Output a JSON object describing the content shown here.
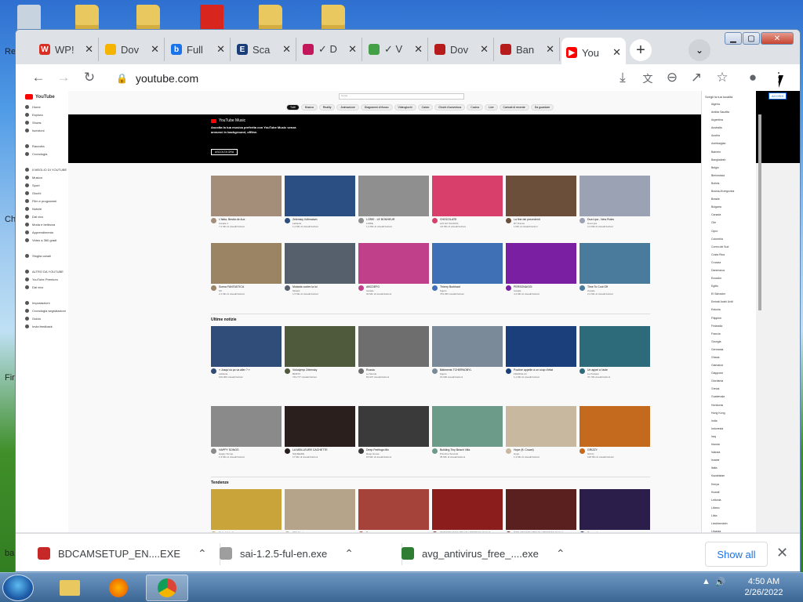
{
  "browser": {
    "tabs": [
      {
        "title": "WP!",
        "fav_color": "#d93025",
        "fav_letter": "W"
      },
      {
        "title": "Dov",
        "fav_color": "#f4b400",
        "fav_letter": ""
      },
      {
        "title": "Full",
        "fav_color": "#1a73e8",
        "fav_letter": "b"
      },
      {
        "title": "Sca",
        "fav_color": "#1a3e7a",
        "fav_letter": "E"
      },
      {
        "title": "✓ D",
        "fav_color": "#c2185b",
        "fav_letter": ""
      },
      {
        "title": "✓ V",
        "fav_color": "#43a047",
        "fav_letter": ""
      },
      {
        "title": "Dov",
        "fav_color": "#b71c1c",
        "fav_letter": ""
      },
      {
        "title": "Ban",
        "fav_color": "#b71c1c",
        "fav_letter": ""
      },
      {
        "title": "You",
        "fav_color": "#ff0000",
        "fav_letter": "▶"
      }
    ],
    "close_glyph": "✕",
    "new_tab_glyph": "+",
    "url": "youtube.com"
  },
  "youtube": {
    "logo": "YouTube",
    "search_placeholder": "Cerca",
    "sidebar": [
      "Home",
      "Esplora",
      "Shorts",
      "Iscrizioni",
      "",
      "Raccolta",
      "Cronologia",
      "",
      "Il MEGLIO DI YOUTUBE",
      "Musica",
      "Sport",
      "Giochi",
      "Film e programmi",
      "Notizie",
      "Dal vivo",
      "Moda e bellezza",
      "Apprendimento",
      "Video a 360 gradi",
      "",
      "Sfoglia canali",
      "",
      "ALTRO DA YOUTUBE",
      "YouTube Premium",
      "Dal vivo",
      "",
      "Impostazioni",
      "Cronologia segnalazioni",
      "Guida",
      "Invia feedback"
    ],
    "chips": [
      "Tutti",
      "Musica",
      "Reality",
      "Animazione",
      "Diagrammi di flusso",
      "Videogiochi",
      "Calcio",
      "Giochi d'avventura",
      "Cucina",
      "Live",
      "Caricati di recente",
      "Da guardare"
    ],
    "banner": {
      "label": "YouTube Music",
      "text": "Ascolta la tua musica preferita con YouTube Music senza annunci in background, offline.",
      "button": "ASCOLTA ORA"
    },
    "login": "ACCEDI",
    "rows": [
      {
        "videos": [
          {
            "title": "L'Italia, Bestia de Aux",
            "channel": "Canale 1",
            "views": "7,2 Mln di visualizzazioni",
            "thumb": "#a48e7a"
          },
          {
            "title": "Zelensky l'ultimatum",
            "channel": "LaDante",
            "views": "1,2 Mln di visualizzazioni",
            "thumb": "#2b4f82"
          },
          {
            "title": "LORIE - LE BONHEUR",
            "channel": "LORIE",
            "views": "1,4 Mln di visualizzazioni",
            "thumb": "#8f8f8f"
          },
          {
            "title": "CHOCOLATE",
            "channel": "123 GO SCHOOL",
            "views": "4,6 Mln di visualizzazioni",
            "thumb": "#d83f6b"
          },
          {
            "title": "La fine dei precedenti",
            "channel": "RT France",
            "views": "1 Mln di visualizzazioni",
            "thumb": "#6b4f3a"
          },
          {
            "title": "Dua Lipa - New Rules",
            "channel": "Dua Lipa",
            "views": "2,3 Mld di visualizzazioni",
            "thumb": "#9aa2b3"
          }
        ]
      },
      {
        "videos": [
          {
            "title": "Scena FANTASTICA",
            "channel": "KK",
            "views": "2,1 Mln di visualizzazioni",
            "thumb": "#9a8464"
          },
          {
            "title": "Motards contre la loi",
            "channel": "Motard",
            "views": "1,5 Mln di visualizzazioni",
            "thumb": "#55606c"
          },
          {
            "title": "ABCDEFG",
            "channel": "Canale",
            "views": "32 Mln di visualizzazioni",
            "thumb": "#c0408a"
          },
          {
            "title": "Thierry Burkhard",
            "channel": "Figaro",
            "views": "763.450 visualizzazioni",
            "thumb": "#3f6fb5"
          },
          {
            "title": "PERSONAGGI",
            "channel": "Canale",
            "views": "4,4 Mln di visualizzazioni",
            "thumb": "#7b1fa2"
          },
          {
            "title": "Time To Cool Off",
            "channel": "Canale",
            "views": "2,2 Mln di visualizzazioni",
            "thumb": "#4a7b9c"
          }
        ]
      },
      {
        "section": "Ultime notizie",
        "videos": [
          {
            "title": "« Jusqu'où ça va aller ? »",
            "channel": "LaDante",
            "views": "100.000 visualizzazioni",
            "thumb": "#2f4d78"
          },
          {
            "title": "Volodymyr Zelensky",
            "channel": "BFMTV",
            "views": "743.777 visualizzazioni",
            "thumb": "#4f5a3d"
          },
          {
            "title": "Russia",
            "channel": "Le Monde",
            "views": "81.937 visualizzazioni",
            "thumb": "#6e6e6e"
          },
          {
            "title": "Bâtiments TCHERNOBYL",
            "channel": "Figaro",
            "views": "15.000 visualizzazioni",
            "thumb": "#7a8a98"
          },
          {
            "title": "Poutine appelle à un coup d'état",
            "channel": "FRANCE 24",
            "views": "1,1 Mln di visualizzazioni",
            "thumb": "#1a3f7a"
          },
          {
            "title": "Un appel à l'aide",
            "channel": "Le Parisien",
            "views": "37.793 visualizzazioni",
            "thumb": "#2e6b7a"
          }
        ]
      },
      {
        "videos": [
          {
            "title": "HAPPY SONGS",
            "channel": "Happy Songs",
            "views": "1,9 Mln di visualizzazioni",
            "thumb": "#8a8a8a"
          },
          {
            "title": "LA MEILLEURE CACHETTE",
            "channel": "SQUEEZIE",
            "views": "17 Mln di visualizzazioni",
            "thumb": "#2a1f1c"
          },
          {
            "title": "Deep Feelings Mix",
            "channel": "Deep House",
            "views": "16 Mln di visualizzazioni",
            "thumb": "#3a3a3a"
          },
          {
            "title": "Building Tiny Beach Villa",
            "channel": "Primitive Survival",
            "views": "35 Mln di visualizzazioni",
            "thumb": "#6d9b8a"
          },
          {
            "title": "Hope (ft. Crowd)",
            "channel": "Hope",
            "views": "1,3 Mln di visualizzazioni",
            "thumb": "#c9b8a0"
          },
          {
            "title": "GRIZZY",
            "channel": "Grizzy",
            "views": "128 Mln di visualizzazioni",
            "thumb": "#c46a1e"
          }
        ]
      },
      {
        "section": "Tendenze",
        "videos": [
          {
            "title": "Colorful balls",
            "channel": "Canale",
            "views": "",
            "thumb": "#c8a43a"
          },
          {
            "title": "306 Maxi",
            "channel": "Canale",
            "views": "",
            "thumb": "#b5a38a"
          },
          {
            "title": "Pom-pom",
            "channel": "Canale",
            "views": "",
            "thumb": "#a5423a"
          },
          {
            "title": "PRESSEASON TRACK SESSION DAY 2",
            "channel": "F1",
            "views": "",
            "thumb": "#8c1d1d"
          },
          {
            "title": "PRE-SEASON TRACK SESSION DAY 1",
            "channel": "F1",
            "views": "",
            "thumb": "#5a2020"
          },
          {
            "title": "Europa League",
            "channel": "Canale",
            "views": "",
            "thumb": "#2b1e4a"
          }
        ]
      }
    ],
    "languages_header": "Scegli la tua località",
    "languages": [
      "Algeria",
      "Arabia Saudita",
      "Argentina",
      "Australia",
      "Austria",
      "Azerbaigian",
      "Bahrein",
      "Bangladesh",
      "Belgio",
      "Bielorussia",
      "Bolivia",
      "Bosnia-Erzegovina",
      "Brasile",
      "Bulgaria",
      "Canada",
      "Cile",
      "Cipro",
      "Colombia",
      "Corea del Sud",
      "Costa Rica",
      "Croazia",
      "Danimarca",
      "Ecuador",
      "Egitto",
      "El Salvador",
      "Emirati Arabi Uniti",
      "Estonia",
      "Filippine",
      "Finlandia",
      "Francia",
      "Georgia",
      "Germania",
      "Ghana",
      "Giamaica",
      "Giappone",
      "Giordania",
      "Grecia",
      "Guatemala",
      "Honduras",
      "Hong Kong",
      "India",
      "Indonesia",
      "Iraq",
      "Irlanda",
      "Islanda",
      "Israele",
      "Italia",
      "Kazakistan",
      "Kenya",
      "Kuwait",
      "Lettonia",
      "Libano",
      "Libia",
      "Liechtenstein",
      "Lituania"
    ]
  },
  "downloads": [
    {
      "name": "BDCAMSETUP_EN....EXE",
      "color": "#c62828"
    },
    {
      "name": "sai-1.2.5-ful-en.exe",
      "color": "#9e9e9e"
    },
    {
      "name": "avg_antivirus_free_....exe",
      "color": "#2e7d32"
    }
  ],
  "show_all": "Show all",
  "taskbar": {
    "time": "4:50 AM",
    "date": "2/26/2022"
  },
  "desktop_edge_text": [
    "Re",
    "Ch",
    "Fir",
    "ba"
  ]
}
